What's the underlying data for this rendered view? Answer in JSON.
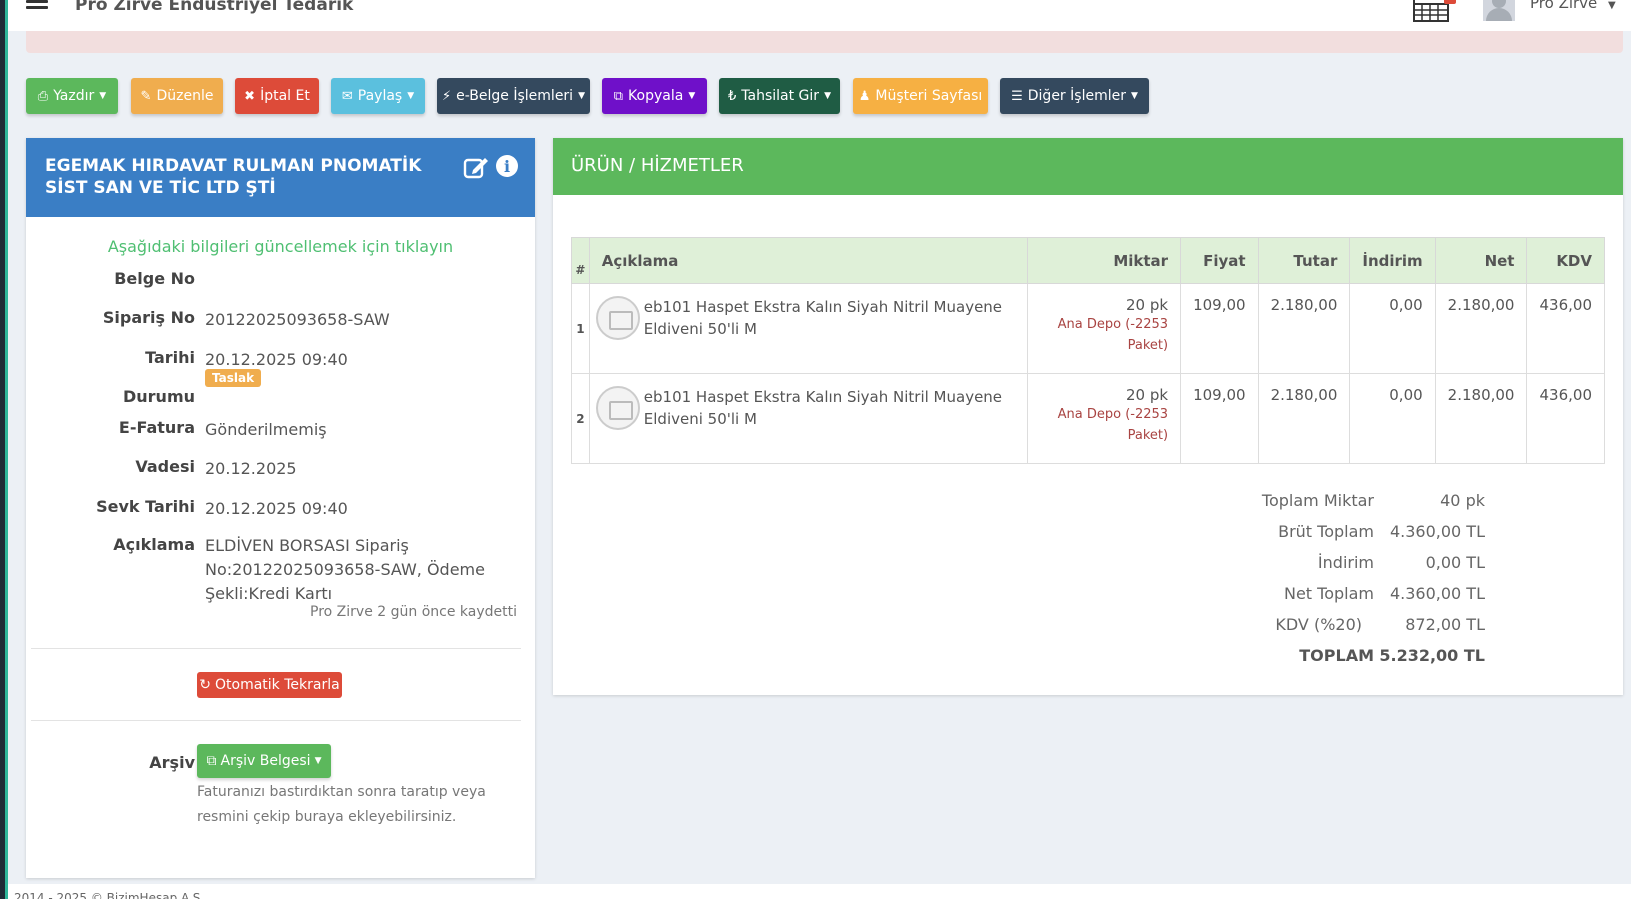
{
  "header": {
    "company": "Pro Zirve Endüstriyel Tedarik",
    "user": "Pro Zirve"
  },
  "toolbar": {
    "print": "Yazdır",
    "edit": "Düzenle",
    "cancel": "İptal Et",
    "share": "Paylaş",
    "ebelge": "e-Belge İşlemleri",
    "copy": "Kopyala",
    "collect": "Tahsilat Gir",
    "customer_page": "Müşteri Sayfası",
    "other": "Diğer İşlemler",
    "colors": {
      "green": "#5cb85c",
      "orange": "#f0ad4e",
      "red": "#dd4b39",
      "cyan": "#5bc0de",
      "dark": "#34495e",
      "purple": "#6f10c9",
      "teal": "#1f5c44",
      "amber": "#f6b043"
    }
  },
  "customer": {
    "name": "EGEMAK HIRDAVAT RULMAN PNOMATİK SİST SAN VE TİC LTD ŞTİ",
    "update_hint": "Aşağıdaki bilgileri güncellemek için tıklayın",
    "fields": {
      "belge_no_label": "Belge No",
      "belge_no": "",
      "siparis_no_label": "Sipariş No",
      "siparis_no": "20122025093658-SAW",
      "tarih_label": "Tarihi",
      "tarih": "20.12.2025 09:40",
      "durum_label": "Durumu",
      "durum": "Taslak",
      "efatura_label": "E-Fatura",
      "efatura": "Gönderilmemiş",
      "vade_label": "Vadesi",
      "vade": "20.12.2025",
      "sevk_label": "Sevk Tarihi",
      "sevk": "20.12.2025 09:40",
      "aciklama_label": "Açıklama",
      "aciklama": "ELDİVEN BORSASI Sipariş No:20122025093658-SAW, Ödeme Şekli:Kredi Kartı"
    },
    "saved_by": "Pro Zirve 2 gün önce kaydetti",
    "auto_repeat": "Otomatik Tekrarla",
    "archive_label": "Arşiv",
    "archive_button": "Arşiv Belgesi",
    "archive_help": "Faturanızı bastırdıktan sonra taratıp veya resmini çekip buraya ekleyebilirsiniz."
  },
  "products": {
    "title": "ÜRÜN / HİZMETLER",
    "columns": [
      "#",
      "Açıklama",
      "Miktar",
      "Fiyat",
      "Tutar",
      "İndirim",
      "Net",
      "KDV"
    ],
    "rows": [
      {
        "num": "1",
        "desc": "eb101 Haspet Ekstra Kalın Siyah Nitril Muayene Eldiveni 50'li M",
        "qty": "20 pk",
        "depot": "Ana Depo (-2253 Paket)",
        "price": "109,00",
        "amount": "2.180,00",
        "discount": "0,00",
        "net": "2.180,00",
        "vat": "436,00"
      },
      {
        "num": "2",
        "desc": "eb101 Haspet Ekstra Kalın Siyah Nitril Muayene Eldiveni 50'li M",
        "qty": "20 pk",
        "depot": "Ana Depo (-2253 Paket)",
        "price": "109,00",
        "amount": "2.180,00",
        "discount": "0,00",
        "net": "2.180,00",
        "vat": "436,00"
      }
    ]
  },
  "totals": {
    "total_qty_label": "Toplam Miktar",
    "total_qty": "40 pk",
    "gross_label": "Brüt Toplam",
    "gross": "4.360,00 TL",
    "discount_label": "İndirim",
    "discount": "0,00 TL",
    "net_label": "Net Toplam",
    "net": "4.360,00 TL",
    "vat_label": "KDV (%20)",
    "vat": "872,00 TL",
    "grand_label": "TOPLAM",
    "grand": "5.232,00 TL"
  },
  "footer": {
    "copyright": "2014 - 2025 © BizimHesap A.Ş."
  }
}
